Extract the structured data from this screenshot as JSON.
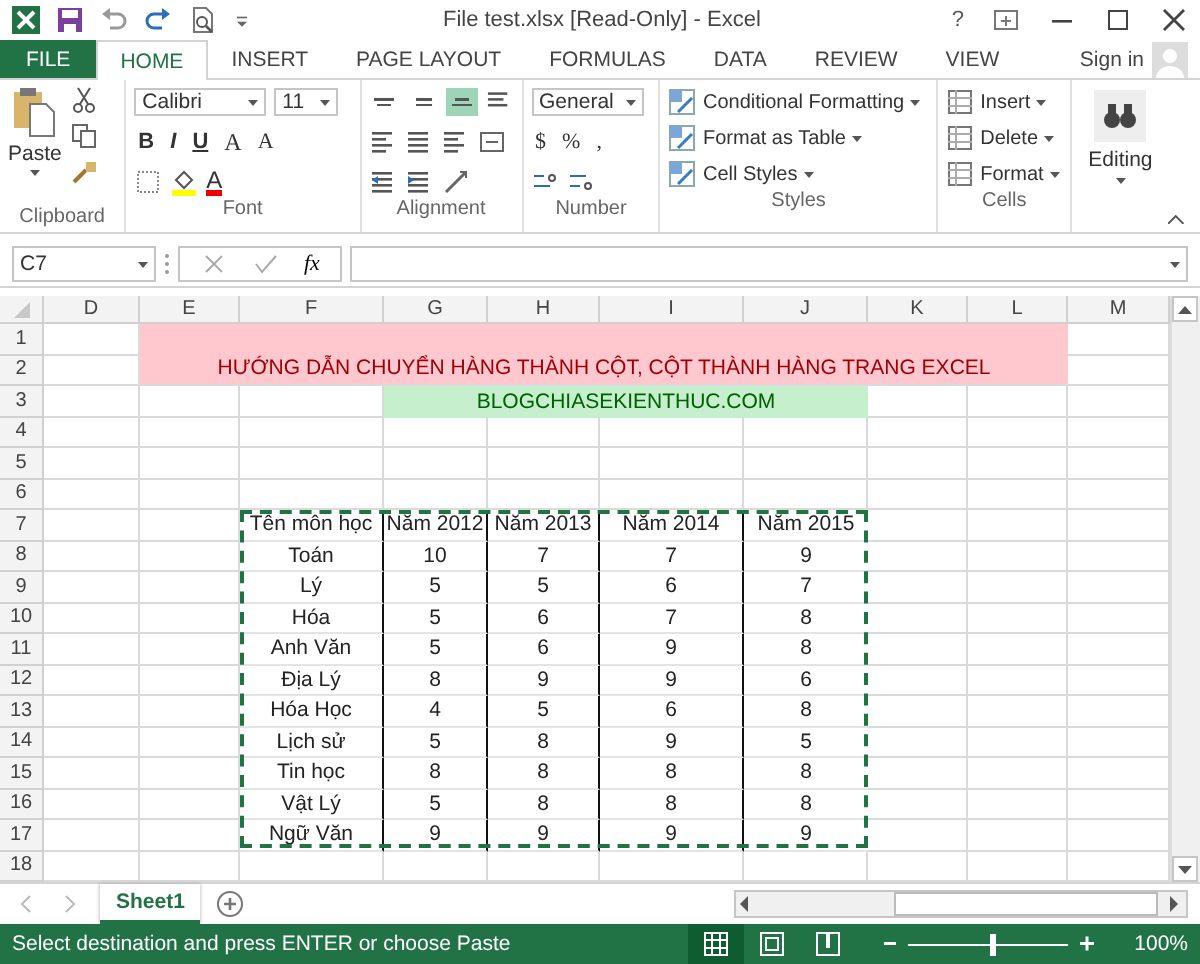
{
  "window": {
    "title": "File test.xlsx  [Read-Only] - Excel",
    "help": "?"
  },
  "tabs": [
    {
      "label": "FILE",
      "kind": "file",
      "selected": false
    },
    {
      "label": "HOME",
      "kind": "tab",
      "selected": true
    },
    {
      "label": "INSERT",
      "kind": "tab",
      "selected": false
    },
    {
      "label": "PAGE LAYOUT",
      "kind": "tab",
      "selected": false
    },
    {
      "label": "FORMULAS",
      "kind": "tab",
      "selected": false
    },
    {
      "label": "DATA",
      "kind": "tab",
      "selected": false
    },
    {
      "label": "REVIEW",
      "kind": "tab",
      "selected": false
    },
    {
      "label": "VIEW",
      "kind": "tab",
      "selected": false
    }
  ],
  "account": {
    "label": "Sign in"
  },
  "ribbon": {
    "clipboard": {
      "paste": "Paste",
      "label": "Clipboard"
    },
    "font": {
      "family": "Calibri",
      "size": "11",
      "bold": "B",
      "italic": "I",
      "underline": "U",
      "grow": "A",
      "shrink": "A",
      "color_button": "A",
      "label": "Font"
    },
    "alignment": {
      "label": "Alignment",
      "vertical": [
        {
          "kind": "top",
          "selected": false
        },
        {
          "kind": "middle",
          "selected": false
        },
        {
          "kind": "bottom",
          "selected": true
        }
      ]
    },
    "number": {
      "format": "General",
      "currency": "$",
      "percent": "%",
      "comma": ",",
      "label": "Number"
    },
    "styles": {
      "items": [
        "Conditional Formatting",
        "Format as Table",
        "Cell Styles"
      ],
      "label": "Styles"
    },
    "cells": {
      "items": [
        "Insert",
        "Delete",
        "Format"
      ],
      "label": "Cells"
    },
    "editing": {
      "label": "Editing"
    }
  },
  "formula_bar": {
    "name_box": "C7",
    "function_button": "fx"
  },
  "sheet": {
    "columns": [
      "D",
      "E",
      "F",
      "G",
      "H",
      "I",
      "J",
      "K",
      "L",
      "M"
    ],
    "rows": [
      "1",
      "2",
      "3",
      "4",
      "5",
      "6",
      "7",
      "8",
      "9",
      "10",
      "11",
      "12",
      "13",
      "14",
      "15",
      "16",
      "17",
      "18"
    ],
    "banner": "HƯỚNG DẪN CHUYỂN HÀNG THÀNH CỘT, CỘT THÀNH HÀNG TRANG EXCEL",
    "link": "BLOGCHIASEKIENTHUC.COM",
    "table": {
      "header": [
        "Tên môn học",
        "Năm 2012",
        "Năm 2013",
        "Năm 2014",
        "Năm 2015"
      ],
      "rows": [
        [
          "Toán",
          "10",
          "7",
          "7",
          "9"
        ],
        [
          "Lý",
          "5",
          "5",
          "6",
          "7"
        ],
        [
          "Hóa",
          "5",
          "6",
          "7",
          "8"
        ],
        [
          "Anh Văn",
          "5",
          "6",
          "9",
          "8"
        ],
        [
          "Địa Lý",
          "8",
          "9",
          "9",
          "6"
        ],
        [
          "Hóa Học",
          "4",
          "5",
          "6",
          "8"
        ],
        [
          "Lịch sử",
          "5",
          "8",
          "9",
          "5"
        ],
        [
          "Tin học",
          "8",
          "8",
          "8",
          "8"
        ],
        [
          "Vật Lý",
          "5",
          "8",
          "8",
          "8"
        ],
        [
          "Ngữ Văn",
          "9",
          "9",
          "9",
          "9"
        ]
      ]
    }
  },
  "sheet_tabs": [
    {
      "label": "Sheet1",
      "selected": true
    }
  ],
  "status_bar": {
    "message": "Select destination and press ENTER or choose Paste",
    "views": [
      {
        "kind": "normal",
        "selected": true
      },
      {
        "kind": "page_layout",
        "selected": false
      },
      {
        "kind": "page_break",
        "selected": false
      }
    ],
    "zoom": {
      "level": 0.52,
      "reading": "100%"
    }
  }
}
